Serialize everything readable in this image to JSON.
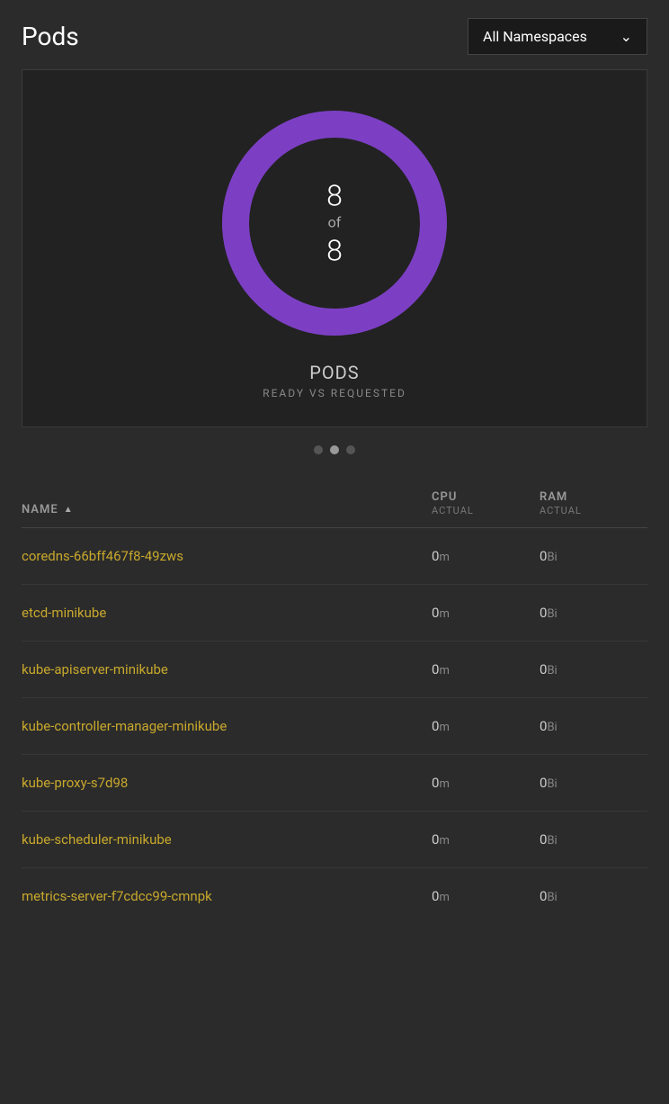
{
  "header": {
    "title": "Pods",
    "namespace_label": "All Namespaces"
  },
  "chart": {
    "ready": 8,
    "of_label": "of",
    "requested": 8,
    "label": "PODS",
    "sublabel": "READY VS REQUESTED",
    "donut": {
      "percentage": 100,
      "color": "#7c3fc4",
      "bg_color": "#3a3a3a",
      "radius": 110,
      "stroke_width": 30
    }
  },
  "pagination": {
    "dots": [
      {
        "active": false
      },
      {
        "active": true
      },
      {
        "active": false
      }
    ]
  },
  "table": {
    "columns": {
      "name": "NAME",
      "cpu_top": "CPU",
      "cpu_bottom": "ACTUAL",
      "ram_top": "RAM",
      "ram_bottom": "ACTUAL"
    },
    "rows": [
      {
        "name": "coredns-66bff467f8-49zws",
        "cpu": "0",
        "cpu_unit": "m",
        "ram": "0",
        "ram_unit": "Bi"
      },
      {
        "name": "etcd-minikube",
        "cpu": "0",
        "cpu_unit": "m",
        "ram": "0",
        "ram_unit": "Bi"
      },
      {
        "name": "kube-apiserver-minikube",
        "cpu": "0",
        "cpu_unit": "m",
        "ram": "0",
        "ram_unit": "Bi"
      },
      {
        "name": "kube-controller-manager-minikube",
        "cpu": "0",
        "cpu_unit": "m",
        "ram": "0",
        "ram_unit": "Bi"
      },
      {
        "name": "kube-proxy-s7d98",
        "cpu": "0",
        "cpu_unit": "m",
        "ram": "0",
        "ram_unit": "Bi"
      },
      {
        "name": "kube-scheduler-minikube",
        "cpu": "0",
        "cpu_unit": "m",
        "ram": "0",
        "ram_unit": "Bi"
      },
      {
        "name": "metrics-server-f7cdcc99-cmnpk",
        "cpu": "0",
        "cpu_unit": "m",
        "ram": "0",
        "ram_unit": "Bi"
      }
    ]
  }
}
